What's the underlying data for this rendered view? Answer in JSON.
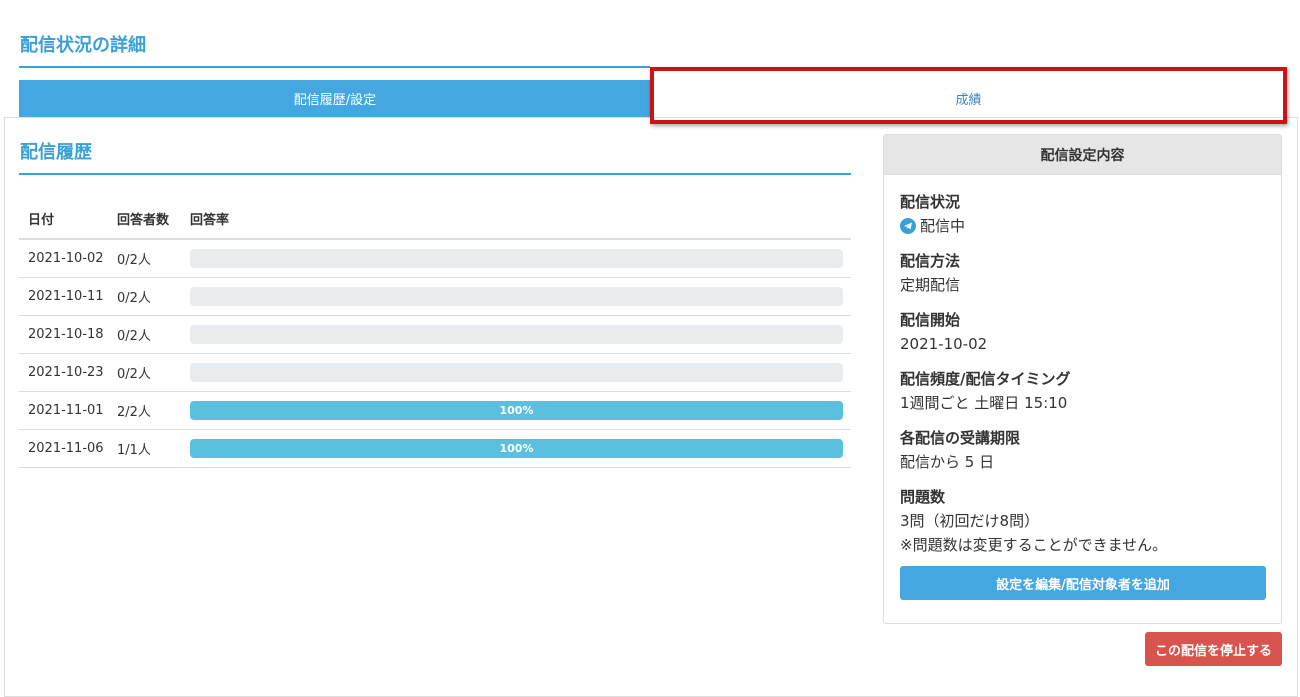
{
  "page": {
    "title": "配信状況の詳細"
  },
  "tabs": [
    {
      "label": "配信履歴/設定",
      "active": true
    },
    {
      "label": "成績",
      "active": false
    }
  ],
  "history": {
    "title": "配信履歴",
    "columns": [
      "日付",
      "回答者数",
      "回答率"
    ],
    "rows": [
      {
        "date": "2021-10-02",
        "respondents": "0/2人",
        "rate": 0,
        "rate_label": ""
      },
      {
        "date": "2021-10-11",
        "respondents": "0/2人",
        "rate": 0,
        "rate_label": ""
      },
      {
        "date": "2021-10-18",
        "respondents": "0/2人",
        "rate": 0,
        "rate_label": ""
      },
      {
        "date": "2021-10-23",
        "respondents": "0/2人",
        "rate": 0,
        "rate_label": ""
      },
      {
        "date": "2021-11-01",
        "respondents": "2/2人",
        "rate": 100,
        "rate_label": "100%"
      },
      {
        "date": "2021-11-06",
        "respondents": "1/1人",
        "rate": 100,
        "rate_label": "100%"
      }
    ]
  },
  "settings": {
    "title": "配信設定内容",
    "status_label": "配信状況",
    "status_value": "配信中",
    "method_label": "配信方法",
    "method_value": "定期配信",
    "start_label": "配信開始",
    "start_value": "2021-10-02",
    "frequency_label": "配信頻度/配信タイミング",
    "frequency_value": "1週間ごと 土曜日 15:10",
    "deadline_label": "各配信の受講期限",
    "deadline_value": "配信から 5 日",
    "questions_label": "問題数",
    "questions_value": "3問（初回だけ8問）",
    "questions_note": "※問題数は変更することができません。",
    "edit_button": "設定を編集/配信対象者を追加"
  },
  "stop_button": "この配信を停止する",
  "colors": {
    "accent": "#44a7e2",
    "progress": "#5bc0de",
    "danger": "#d9534f",
    "highlight": "#c81414"
  },
  "icons": {
    "status": "telegram-send-icon"
  }
}
